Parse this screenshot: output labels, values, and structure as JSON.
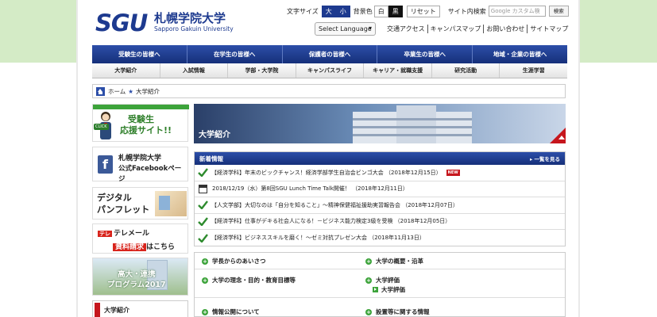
{
  "header": {
    "logo_mark": "SGU",
    "logo_name": "札幌学院大学",
    "logo_sub": "Sapporo Gakuin University",
    "font_size_label": "文字サイズ",
    "font_size_large": "大",
    "font_size_small": "小",
    "bg_color_label": "背景色",
    "bg_white": "白",
    "bg_black": "黒",
    "reset": "リセット",
    "site_search_label": "サイト内検索",
    "search_placeholder": "Google カスタム検",
    "search_button": "検索",
    "language_select": "Select Language",
    "util_links": [
      "交通アクセス",
      "キャンパスマップ",
      "お問い合わせ",
      "サイトマップ"
    ]
  },
  "nav_main": [
    "受験生の皆様へ",
    "在学生の皆様へ",
    "保護者の皆様へ",
    "卒業生の皆様へ",
    "地域・企業の皆様へ"
  ],
  "nav_sub": [
    "大学紹介",
    "入試情報",
    "学部・大学院",
    "キャンパスライフ",
    "キャリア・就職支援",
    "研究活動",
    "生涯学習"
  ],
  "breadcrumb": {
    "home": "ホーム",
    "sep": "★",
    "current": "大学紹介"
  },
  "banners": {
    "exam_click": "CLICK",
    "exam_line1": "受験生",
    "exam_line2": "応援サイト!!",
    "fb_line1": "札幌学院大学",
    "fb_line2": "公式Facebookページ",
    "digital_line1": "デジタル",
    "digital_line2": "パンフレット",
    "tel_logo_mark": "テレ",
    "tel_logo": "テレメール",
    "tel_req_red": "資料請求",
    "tel_req": "はこちら",
    "hs_line1": "高大・連携",
    "hs_line2": "プログラム2017"
  },
  "side_menu": {
    "label": "大学紹介"
  },
  "hero": {
    "title": "大学紹介"
  },
  "news": {
    "title": "新着情報",
    "more": "一覧を見る",
    "items": [
      {
        "text": "【経済学科】年末のビックチャンス！経済学部学生自治会ビンゴ大会 （2018年12月15日）",
        "new": "NEW",
        "icon": "check-icon"
      },
      {
        "text": "2018/12/19（水）第8回SGU Lunch Time Talk開催！ （2018年12月11日）",
        "icon": "calendar-icon"
      },
      {
        "text": "【人文学部】大切なのは「自分を知ること」～精神保健福祉援助実習報告会 （2018年12月07日）",
        "icon": "check-icon"
      },
      {
        "text": "【経済学科】仕事がデキる社会人になる！－ビジネス能力検定3級を受検 （2018年12月05日）",
        "icon": "check-icon"
      },
      {
        "text": "【経済学科】ビジネススキルを磨く！～ゼミ対抗プレゼン大会 （2018年11月13日）",
        "icon": "check-icon"
      }
    ]
  },
  "links": {
    "message": "学長からのあいさつ",
    "overview": "大学の概要・沿革",
    "philosophy": "大学の理念・目的・教育目標等",
    "evaluation": "大学評価",
    "evaluation_sub": "大学評価",
    "disclosure": "情報公開について",
    "establishment": "設置等に関する情報"
  },
  "colors": {
    "brand_blue": "#1d3a8f",
    "accent_red": "#c6161d",
    "green": "#3ca33a",
    "bg_green": "#d4ebc6"
  }
}
